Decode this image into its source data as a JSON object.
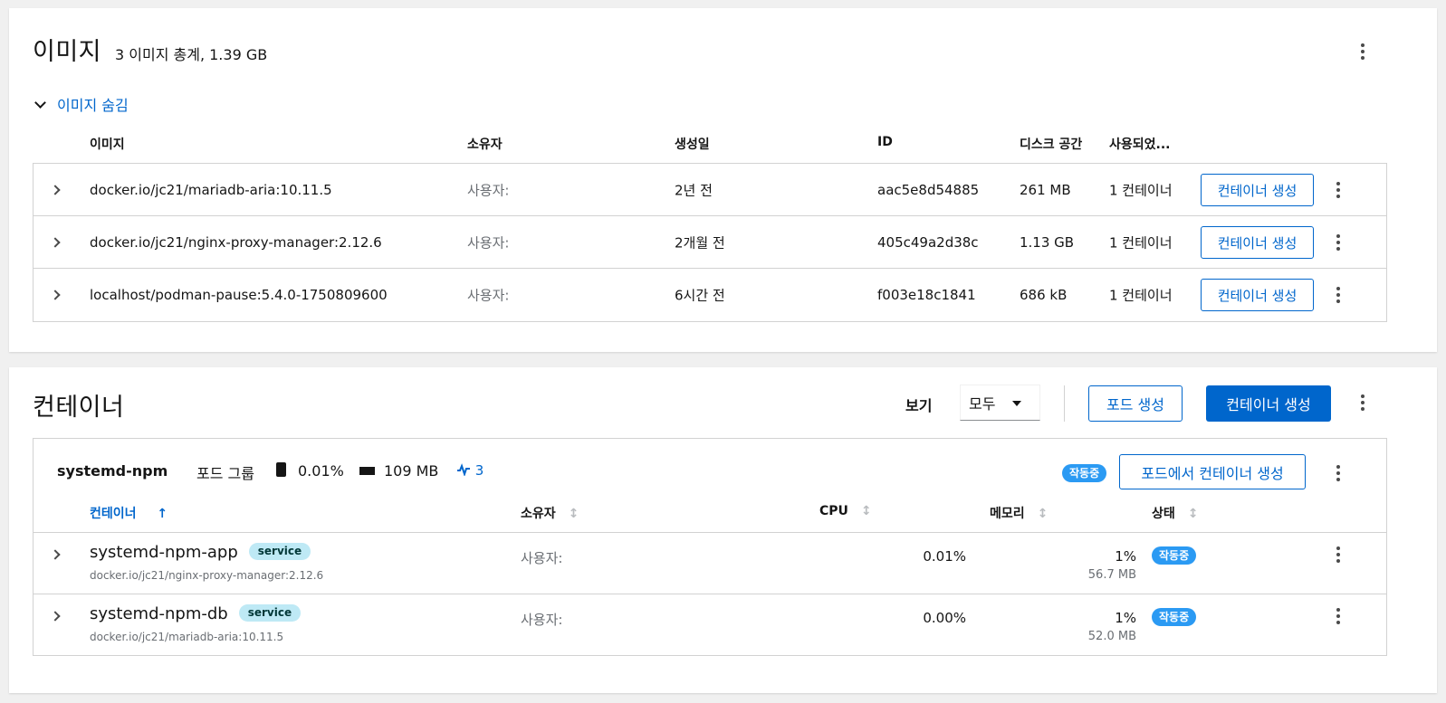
{
  "images": {
    "title": "이미지",
    "summary": "3 이미지 총계, 1.39 GB",
    "toggle_label": "이미지 숨김",
    "columns": [
      "이미지",
      "소유자",
      "생성일",
      "ID",
      "디스크 공간",
      "사용되었..."
    ],
    "rows": [
      {
        "name": "docker.io/jc21/mariadb-aria:10.11.5",
        "owner": "사용자:",
        "created": "2년 전",
        "id": "aac5e8d54885",
        "size": "261 MB",
        "used": "1 컨테이너",
        "action": "컨테이너 생성"
      },
      {
        "name": "docker.io/jc21/nginx-proxy-manager:2.12.6",
        "owner": "사용자:",
        "created": "2개월 전",
        "id": "405c49a2d38c",
        "size": "1.13 GB",
        "used": "1 컨테이너",
        "action": "컨테이너 생성"
      },
      {
        "name": "localhost/podman-pause:5.4.0-1750809600",
        "owner": "사용자:",
        "created": "6시간 전",
        "id": "f003e18c1841",
        "size": "686 kB",
        "used": "1 컨테이너",
        "action": "컨테이너 생성"
      }
    ]
  },
  "containers": {
    "title": "컨테이너",
    "view_label": "보기",
    "view_value": "모두",
    "create_pod_label": "포드 생성",
    "create_container_label": "컨테이너 생성",
    "pod": {
      "name": "systemd-npm",
      "group_label": "포드 그룹",
      "cpu": "0.01%",
      "memory": "109 MB",
      "count": "3",
      "status": "작동중",
      "create_in_pod_label": "포드에서 컨테이너 생성"
    },
    "columns": [
      "컨테이너",
      "소유자",
      "CPU",
      "메모리",
      "상태"
    ],
    "sort_arrow": "↑",
    "sort_neutral": "↕",
    "rows": [
      {
        "name": "systemd-npm-app",
        "tag": "service",
        "image": "docker.io/jc21/nginx-proxy-manager:2.12.6",
        "owner": "사용자:",
        "cpu": "0.01%",
        "mem_pct": "1%",
        "mem": "56.7 MB",
        "status": "작동중"
      },
      {
        "name": "systemd-npm-db",
        "tag": "service",
        "image": "docker.io/jc21/mariadb-aria:10.11.5",
        "owner": "사용자:",
        "cpu": "0.00%",
        "mem_pct": "1%",
        "mem": "52.0 MB",
        "status": "작동중"
      }
    ]
  },
  "colors": {
    "accent": "#0066cc",
    "running_badge": "#2b9af3",
    "service_badge": "#bee9f5"
  },
  "icons": [
    "kebab-icon",
    "chevron-down-icon",
    "chevron-right-icon",
    "cpu-icon",
    "memory-icon",
    "activity-icon",
    "sort-icon",
    "caret-down-icon"
  ]
}
